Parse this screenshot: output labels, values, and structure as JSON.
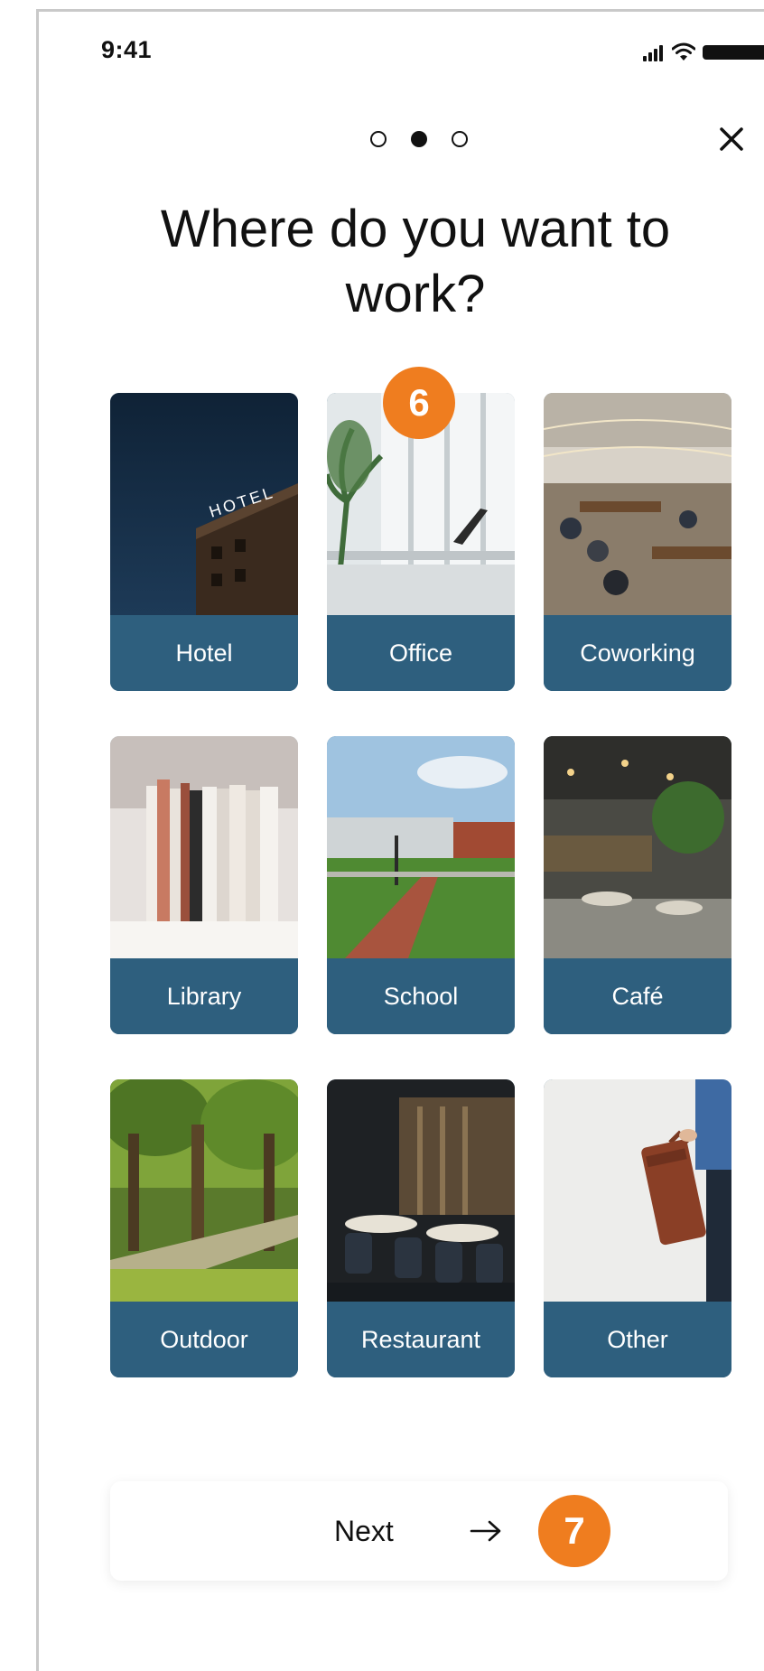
{
  "status_bar": {
    "time": "9:41"
  },
  "onboarding": {
    "step_dots": 3,
    "active_step": 2
  },
  "title": "Where do you want to work?",
  "options": [
    {
      "label": "Hotel",
      "photo": "hotel-sign-night"
    },
    {
      "label": "Office",
      "photo": "bright-office-desk"
    },
    {
      "label": "Coworking",
      "photo": "coworking-space"
    },
    {
      "label": "Library",
      "photo": "books-on-shelf"
    },
    {
      "label": "School",
      "photo": "campus-path"
    },
    {
      "label": "Café",
      "photo": "cafe-interior"
    },
    {
      "label": "Outdoor",
      "photo": "tree-lined-park"
    },
    {
      "label": "Restaurant",
      "photo": "restaurant-dining-room"
    },
    {
      "label": "Other",
      "photo": "person-with-briefcase"
    }
  ],
  "next_button": {
    "label": "Next",
    "icon": "arrow-right-icon"
  },
  "annotations": {
    "badge_6": "6",
    "badge_7": "7"
  },
  "colors": {
    "tile_label_bg": "#2e5f7e",
    "badge": "#ef7d1f",
    "text": "#111111"
  }
}
